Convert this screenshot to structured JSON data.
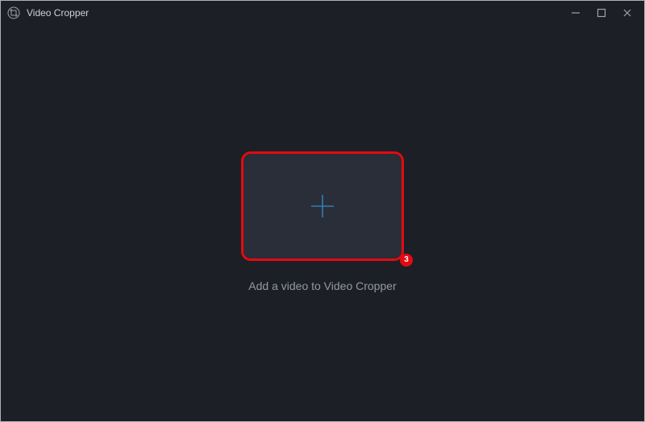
{
  "window": {
    "title": "Video Cropper"
  },
  "content": {
    "hint": "Add a video to Video Cropper",
    "step_badge": "3"
  },
  "icons": {
    "app": "crop-icon",
    "add": "plus-icon",
    "minimize": "minimize-icon",
    "maximize": "maximize-icon",
    "close": "close-icon"
  },
  "colors": {
    "bg": "#1c1f26",
    "panel": "#2a2e38",
    "text_muted": "#9399a3",
    "accent_plus": "#2f7fb5",
    "highlight": "#e40a12"
  }
}
